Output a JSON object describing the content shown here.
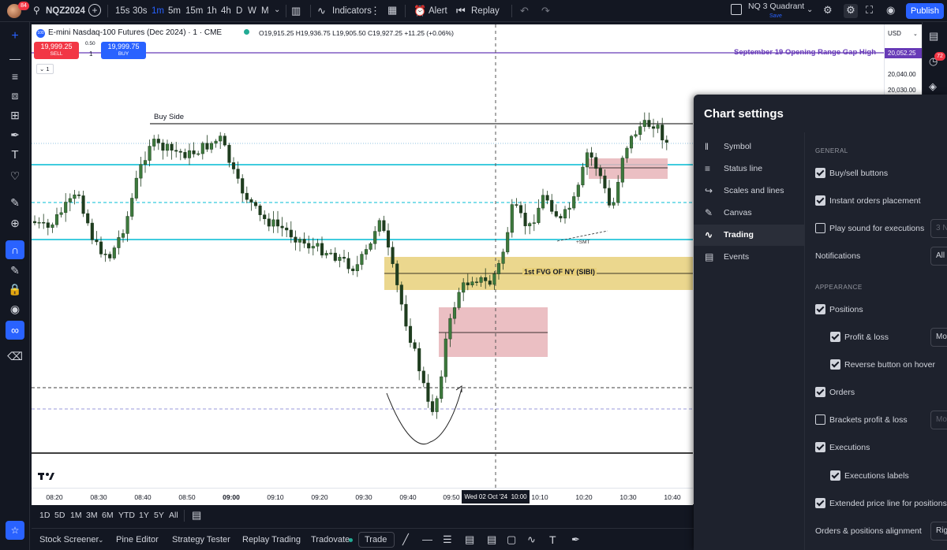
{
  "topbar": {
    "notification_count": "84",
    "symbol": "NQZ2024",
    "timeframes": [
      "15s",
      "30s",
      "1m",
      "5m",
      "15m",
      "1h",
      "4h",
      "D",
      "W",
      "M"
    ],
    "active_timeframe": "1m",
    "indicators_label": "Indicators",
    "alert_label": "Alert",
    "replay_label": "Replay",
    "layout_name": "NQ 3 Quadrant",
    "layout_status": "Save",
    "publish_label": "Publish"
  },
  "legend": {
    "badge": "100",
    "title": "E-mini Nasdaq-100 Futures (Dec 2024) · 1 · CME",
    "ohlc": "O19,915.25 H19,936.75 L19,905.50 C19,927.25 +11.25 (+0.06%)",
    "sell_price": "19,999.25",
    "sell_label": "SELL",
    "spread": "0.50",
    "quantity": "1",
    "buy_price": "19,999.75",
    "buy_label": "BUY",
    "indicator_count": "1"
  },
  "chart_annotations": {
    "level_label": "September 19 Opening Range Gap High",
    "buy_side_label": "Buy Side",
    "fvg_label": "1st FVG OF NY (SIBI)",
    "smt_label": "+SMT",
    "crosshair_time": "Wed 02 Oct '24",
    "crosshair_clock": "10:00"
  },
  "price_scale": {
    "currency": "USD",
    "level_price": "20,052.25",
    "ticks": [
      "20,040.00",
      "20,030.00"
    ]
  },
  "time_axis": [
    "08:20",
    "08:30",
    "08:40",
    "08:50",
    "09:00",
    "09:10",
    "09:20",
    "09:30",
    "09:40",
    "09:50",
    "10:10",
    "10:20",
    "10:30",
    "10:40"
  ],
  "range_bar": [
    "1D",
    "5D",
    "1M",
    "3M",
    "6M",
    "YTD",
    "1Y",
    "5Y",
    "All"
  ],
  "bottom_bar": {
    "tabs": [
      "Stock Screener",
      "Pine Editor",
      "Strategy Tester",
      "Replay Trading",
      "Tradovate"
    ],
    "trade_label": "Trade"
  },
  "right_rail": {
    "badge": "72"
  },
  "settings": {
    "title": "Chart settings",
    "nav": [
      "Symbol",
      "Status line",
      "Scales and lines",
      "Canvas",
      "Trading",
      "Events"
    ],
    "active_nav": "Trading",
    "general_header": "GENERAL",
    "appearance_header": "APPEARANCE",
    "options": {
      "buy_sell": "Buy/sell buttons",
      "instant_orders": "Instant orders placement",
      "play_sound": "Play sound for executions",
      "notifications": "Notifications",
      "positions": "Positions",
      "profit_loss": "Profit & loss",
      "reverse_button": "Reverse button on hover",
      "orders": "Orders",
      "brackets": "Brackets profit & loss",
      "executions": "Executions",
      "executions_labels": "Executions labels",
      "extended_line": "Extended price line for positions",
      "alignment": "Orders & positions alignment"
    },
    "selects": {
      "sound": "3 N",
      "notifications": "All",
      "profit_loss": "Mon",
      "brackets": "Mon",
      "alignment": "Rig"
    }
  },
  "colors": {
    "background": "#131722",
    "panel": "#1e222d",
    "accent": "#2962ff",
    "sell": "#f23645",
    "level_line": "#673ab7",
    "cyan_line": "#00bcd4",
    "fvg_fill": "#e8d07a",
    "ob_fill": "#e8b4b8",
    "candle": "#3d7a3d"
  }
}
